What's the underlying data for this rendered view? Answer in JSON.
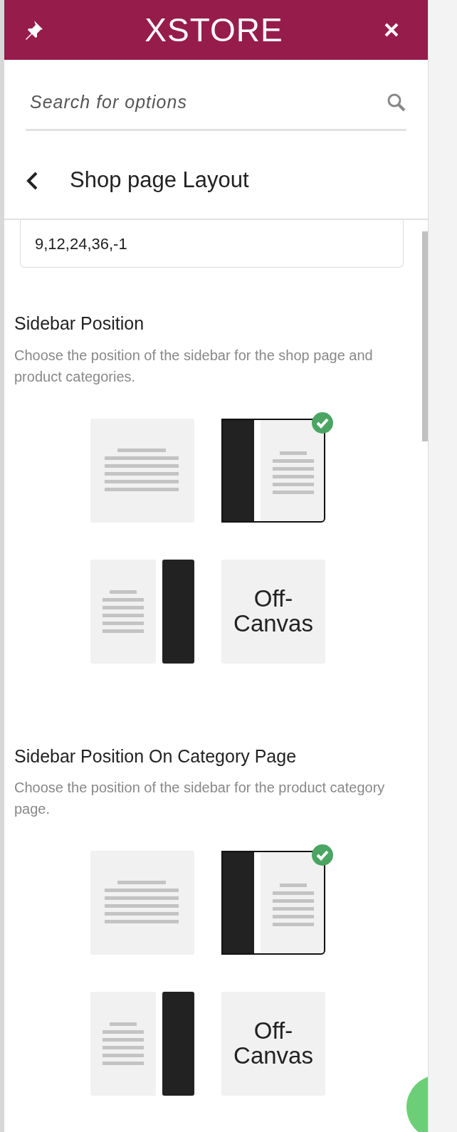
{
  "header": {
    "logo": "XSTORE"
  },
  "search": {
    "placeholder": "Search for options"
  },
  "section_title": "Shop page Layout",
  "field": {
    "value": "9,12,24,36,-1"
  },
  "groups": [
    {
      "title": "Sidebar Position",
      "description": "Choose the position of the sidebar for the shop page and product categories.",
      "options": [
        {
          "kind": "full",
          "selected": false
        },
        {
          "kind": "left",
          "selected": true
        },
        {
          "kind": "right",
          "selected": false
        },
        {
          "kind": "offcanvas",
          "label": "Off-\nCanvas",
          "selected": false
        }
      ]
    },
    {
      "title": "Sidebar Position On Category Page",
      "description": "Choose the position of the sidebar for the product category page.",
      "options": [
        {
          "kind": "full",
          "selected": false
        },
        {
          "kind": "left",
          "selected": true
        },
        {
          "kind": "right",
          "selected": false
        },
        {
          "kind": "offcanvas",
          "label": "Off-\nCanvas",
          "selected": false
        }
      ]
    }
  ]
}
